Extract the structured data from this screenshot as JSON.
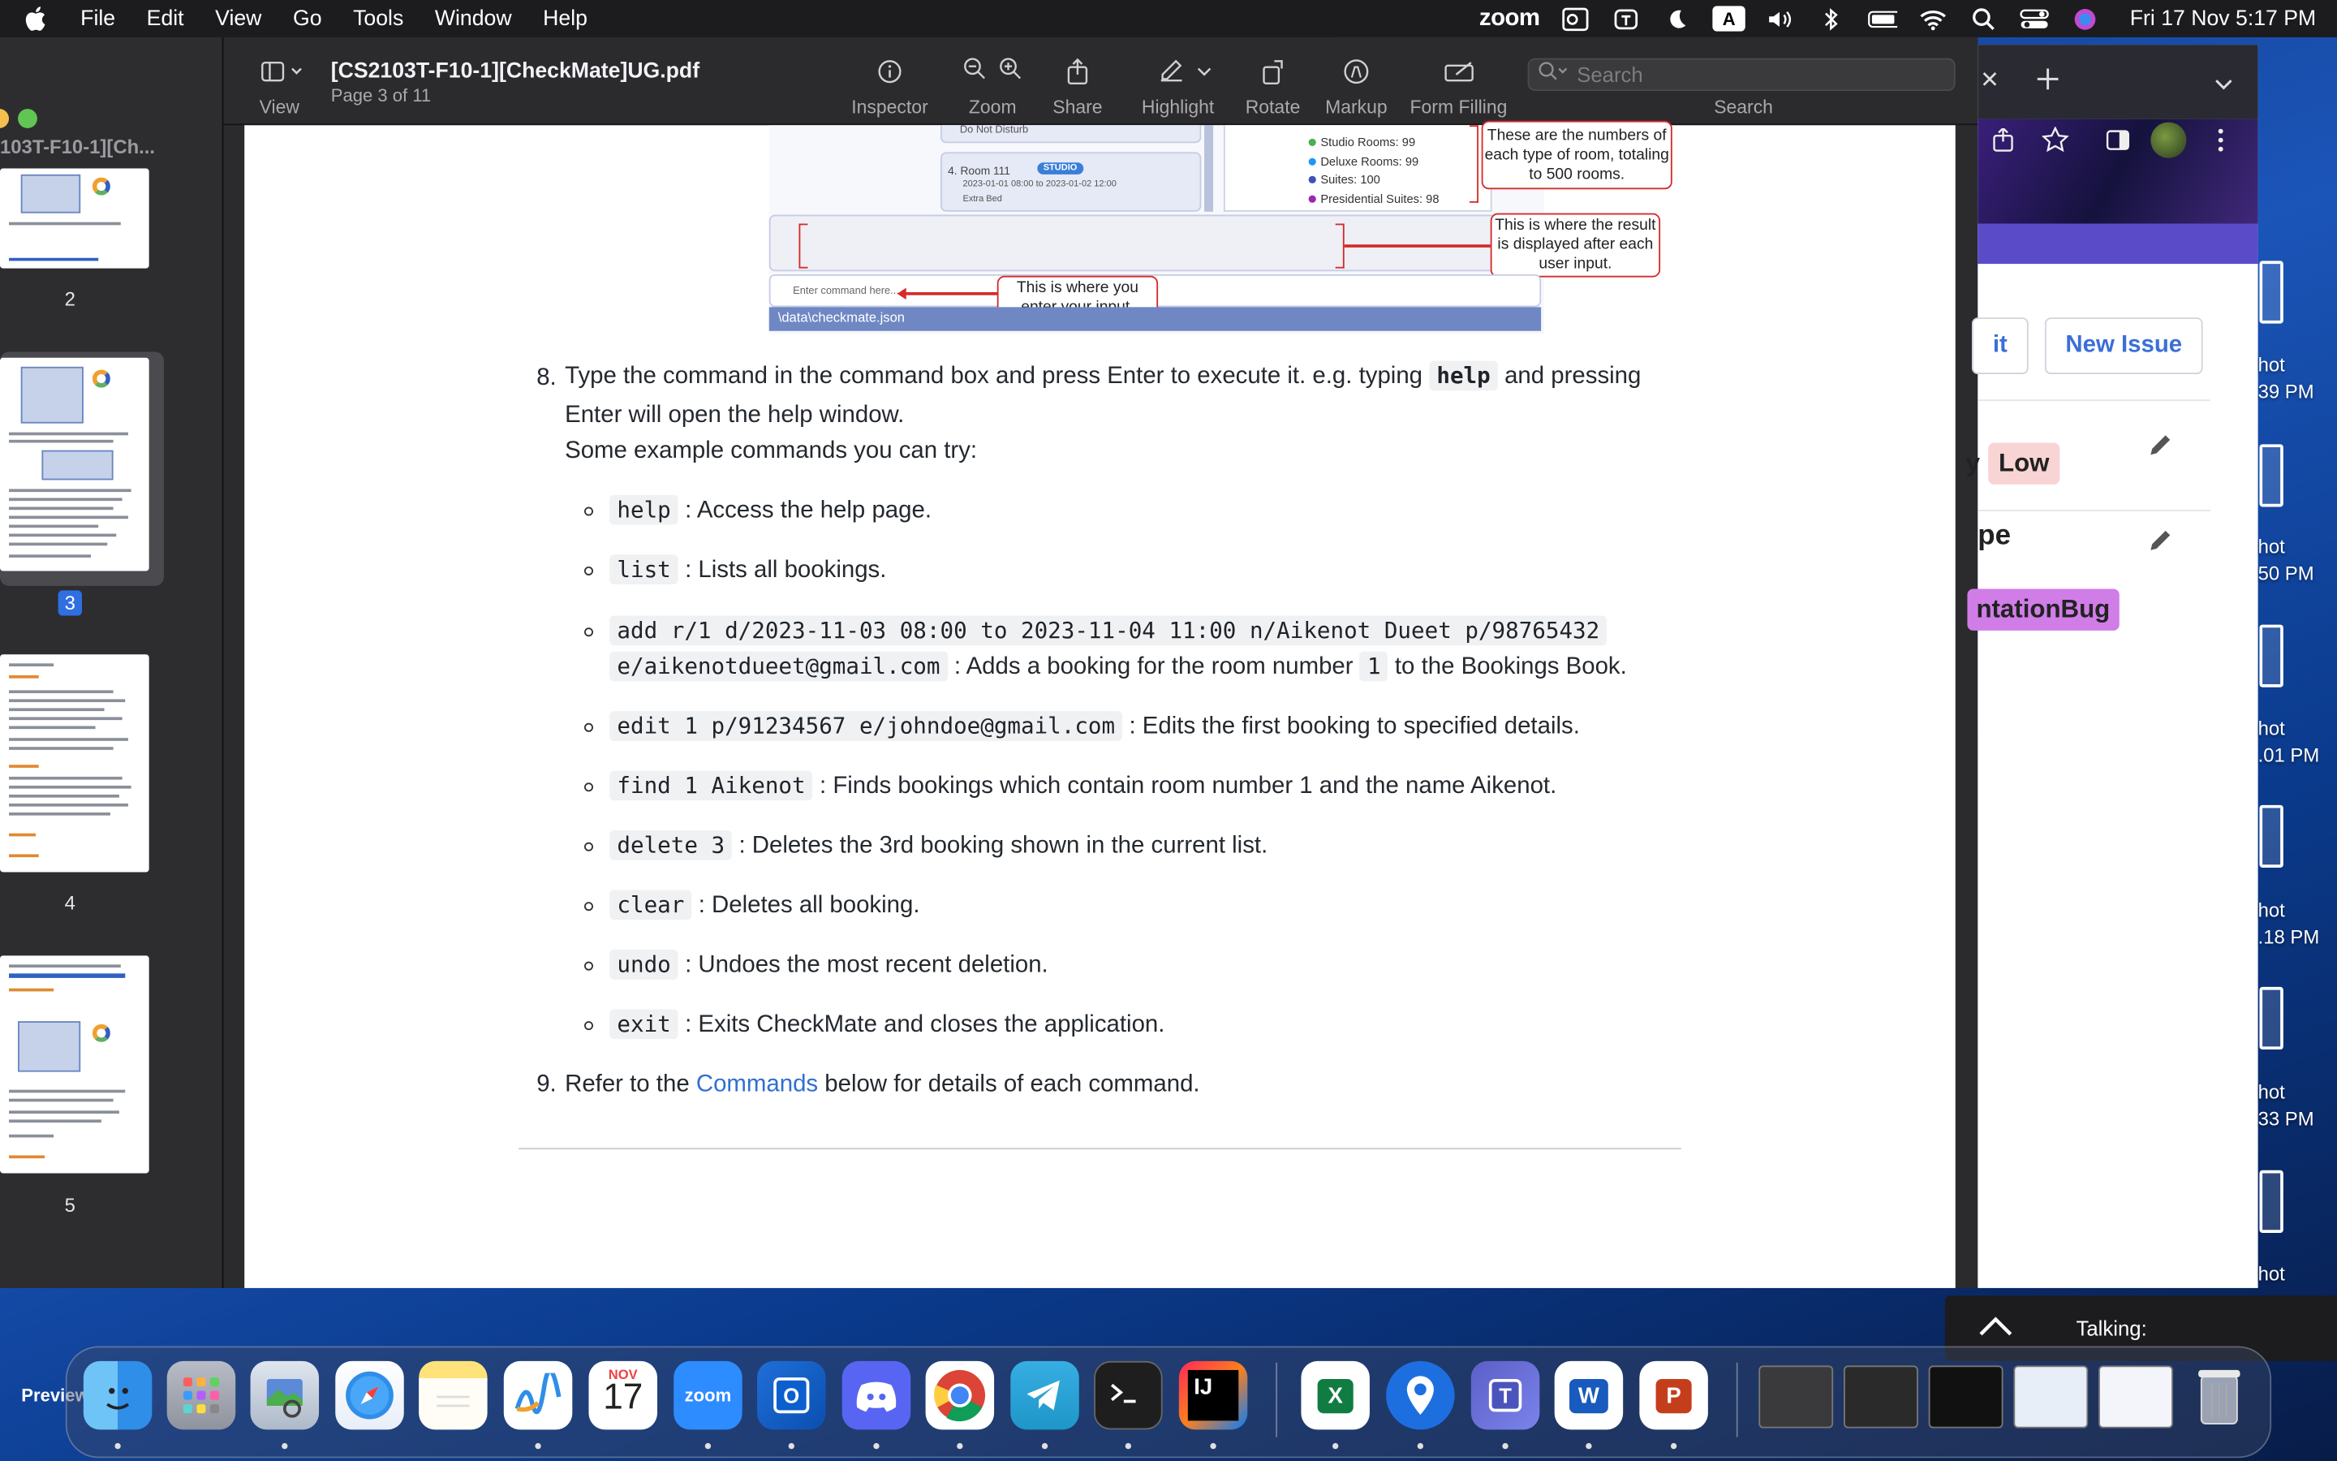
{
  "menubar": {
    "app_name": "Preview",
    "menus": [
      "File",
      "Edit",
      "View",
      "Go",
      "Tools",
      "Window",
      "Help"
    ],
    "status_zoom": "zoom",
    "input_source": "A",
    "clock": "Fri 17 Nov  5:17 PM"
  },
  "sidebar": {
    "title": "103T-F10-1][Ch...",
    "pages": [
      "2",
      "3",
      "4",
      "5"
    ],
    "selected_page": "3"
  },
  "toolbar": {
    "view_label": "View",
    "doc_title": "[CS2103T-F10-1][CheckMate]UG.pdf",
    "doc_subtitle": "Page 3 of 11",
    "inspector_label": "Inspector",
    "zoom_label": "Zoom",
    "share_label": "Share",
    "highlight_label": "Highlight",
    "rotate_label": "Rotate",
    "markup_label": "Markup",
    "form_filling_label": "Form Filling",
    "search_placeholder": "Search",
    "search_label": "Search"
  },
  "figure": {
    "do_not_disturb": "Do Not Disturb",
    "room_card": "4.  Room 111",
    "room_badge": "STUDIO",
    "room_dates": "2023-01-01 08:00 to 2023-01-02 12:00",
    "room_extra": "Extra Bed",
    "stats": [
      "Studio Rooms: 99",
      "Deluxe Rooms: 99",
      "Suites: 100",
      "Presidential Suites: 98"
    ],
    "callout_numbers": "These are the numbers of each type of room, totaling to 500 rooms.",
    "callout_result": "This is where the result is displayed after each user input.",
    "callout_input": "This is where you enter your input.",
    "command_placeholder": "Enter command here...",
    "status_path": "\\data\\checkmate.json"
  },
  "content": {
    "step8_num": "8.",
    "step8_a": "Type the command in the command box and press Enter to execute it. e.g. typing",
    "step8_code": "help",
    "step8_b": "and pressing",
    "step8_c": "Enter will open the help window.",
    "step8_d": "Some example commands you can try:",
    "commands": [
      {
        "code": "help",
        "desc": ": Access the help page."
      },
      {
        "code": "list",
        "desc": ": Lists all bookings."
      },
      {
        "code": "add r/1 d/2023-11-03 08:00 to 2023-11-04 11:00 n/Aikenot Dueet p/98765432",
        "code2": "e/aikenotdueet@gmail.com",
        "desc": ": Adds a booking for the room number",
        "code3": "1",
        "desc2": "to the Bookings Book."
      },
      {
        "code": "edit 1 p/91234567 e/johndoe@gmail.com",
        "desc": ": Edits the first booking to specified details."
      },
      {
        "code": "find 1 Aikenot",
        "desc": ": Finds bookings which contain room number 1 and the name Aikenot."
      },
      {
        "code": "delete 3",
        "desc": ": Deletes the 3rd booking shown in the current list."
      },
      {
        "code": "clear",
        "desc": ": Deletes all booking."
      },
      {
        "code": "undo",
        "desc": ": Undoes the most recent deletion."
      },
      {
        "code": "exit",
        "desc": ": Exits CheckMate and closes the application."
      }
    ],
    "step9_num": "9.",
    "step9_a": "Refer to the",
    "step9_link": "Commands",
    "step9_b": "below for details of each command."
  },
  "browser": {
    "edit_btn_fragment": "it",
    "new_issue": "New Issue",
    "priority_label": "Low",
    "type_fragment": "pe",
    "type_label": "ntationBug",
    "priority_prefix": "y"
  },
  "screenshots": [
    {
      "a": "hot",
      "b": "39 PM"
    },
    {
      "a": "hot",
      "b": "50 PM"
    },
    {
      "a": "hot",
      "b": ".01 PM"
    },
    {
      "a": "hot",
      "b": ".18 PM"
    },
    {
      "a": "hot",
      "b": "33 PM"
    },
    {
      "a": "hot",
      "b": ""
    }
  ],
  "talking": "Talking:",
  "dock": {
    "calendar_month": "NOV",
    "calendar_day": "17",
    "zoom": "zoom",
    "intellij": "IJ",
    "excel": "X",
    "word": "W",
    "powerpoint": "P",
    "outlook": "O"
  },
  "colors": {
    "accent": "#2f6fe0",
    "callout_red": "#d52b2b",
    "link": "#2f6fd0"
  }
}
